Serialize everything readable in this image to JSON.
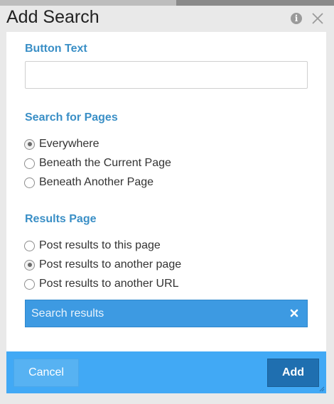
{
  "dialog": {
    "title": "Add Search",
    "info_icon": "info-icon",
    "close_icon": "close-icon"
  },
  "button_text": {
    "label": "Button Text",
    "value": "",
    "placeholder": ""
  },
  "search_for_pages": {
    "label": "Search for Pages",
    "options": [
      {
        "label": "Everywhere",
        "checked": true
      },
      {
        "label": "Beneath the Current Page",
        "checked": false
      },
      {
        "label": "Beneath Another Page",
        "checked": false
      }
    ]
  },
  "results_page": {
    "label": "Results Page",
    "options": [
      {
        "label": "Post results to this page",
        "checked": false
      },
      {
        "label": "Post results to another page",
        "checked": true
      },
      {
        "label": "Post results to another URL",
        "checked": false
      }
    ],
    "selected_page": "Search results",
    "clear_icon": "x-icon"
  },
  "footer": {
    "cancel_label": "Cancel",
    "add_label": "Add"
  },
  "colors": {
    "section_label": "#3a8fc6",
    "footer_bg": "#41a9f5",
    "primary_button": "#1f6fb0",
    "page_chip": "#3d9ae2"
  }
}
